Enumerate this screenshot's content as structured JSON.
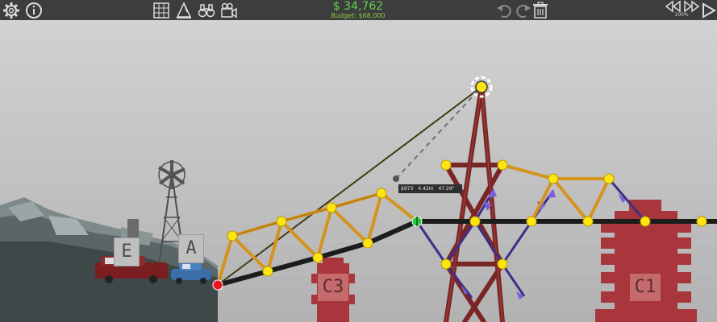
{
  "toolbar": {
    "money": "$ 34,762",
    "budget": "Budget: $68,000",
    "zoom": "100%"
  },
  "colors": {
    "toolbar_bg": "#3d3d3d",
    "money_green": "#5fd34a",
    "wood": "#d4931c",
    "road": "#1c1c1c",
    "steel": "#7a2626",
    "cable": "#3f3a14",
    "spring": "#3d2f8a",
    "joint": "#ffe414",
    "anchor_red": "#e8141e",
    "split_green": "#2ecc40",
    "pier": "#a8363c"
  },
  "icons": [
    "settings-gear-icon",
    "info-icon",
    "grid-icon",
    "measure-icon",
    "binoculars-icon",
    "camera-icon",
    "undo-icon",
    "redo-icon",
    "trash-icon",
    "rewind-icon",
    "play-icon"
  ],
  "signs": {
    "left_vehicle": "E",
    "right_vehicle": "A"
  },
  "piers": {
    "left": "C3",
    "right": "C1"
  },
  "measurement": {
    "cost": "$973",
    "length": "4.42m",
    "angle": "47.29°"
  }
}
